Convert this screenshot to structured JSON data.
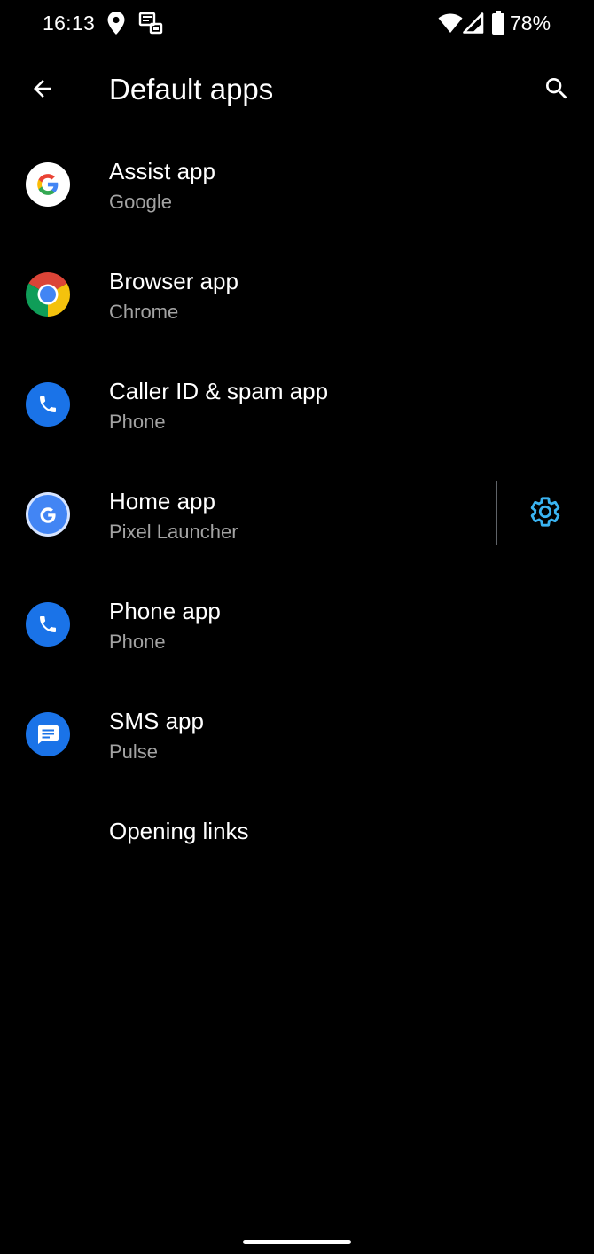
{
  "status_bar": {
    "time": "16:13",
    "battery_percent": "78%"
  },
  "header": {
    "title": "Default apps"
  },
  "items": [
    {
      "title": "Assist app",
      "summary": "Google",
      "icon": "google-g-icon"
    },
    {
      "title": "Browser app",
      "summary": "Chrome",
      "icon": "chrome-icon"
    },
    {
      "title": "Caller ID & spam app",
      "summary": "Phone",
      "icon": "phone-icon"
    },
    {
      "title": "Home app",
      "summary": "Pixel Launcher",
      "icon": "pixel-launcher-icon",
      "has_settings": true
    },
    {
      "title": "Phone app",
      "summary": "Phone",
      "icon": "phone-icon"
    },
    {
      "title": "SMS app",
      "summary": "Pulse",
      "icon": "sms-icon"
    }
  ],
  "opening_links": {
    "label": "Opening links"
  },
  "colors": {
    "background": "#000000",
    "text_primary": "#ffffff",
    "text_secondary": "#a3a3a3",
    "accent": "#3ab4f2",
    "phone_blue": "#1a73e8"
  }
}
